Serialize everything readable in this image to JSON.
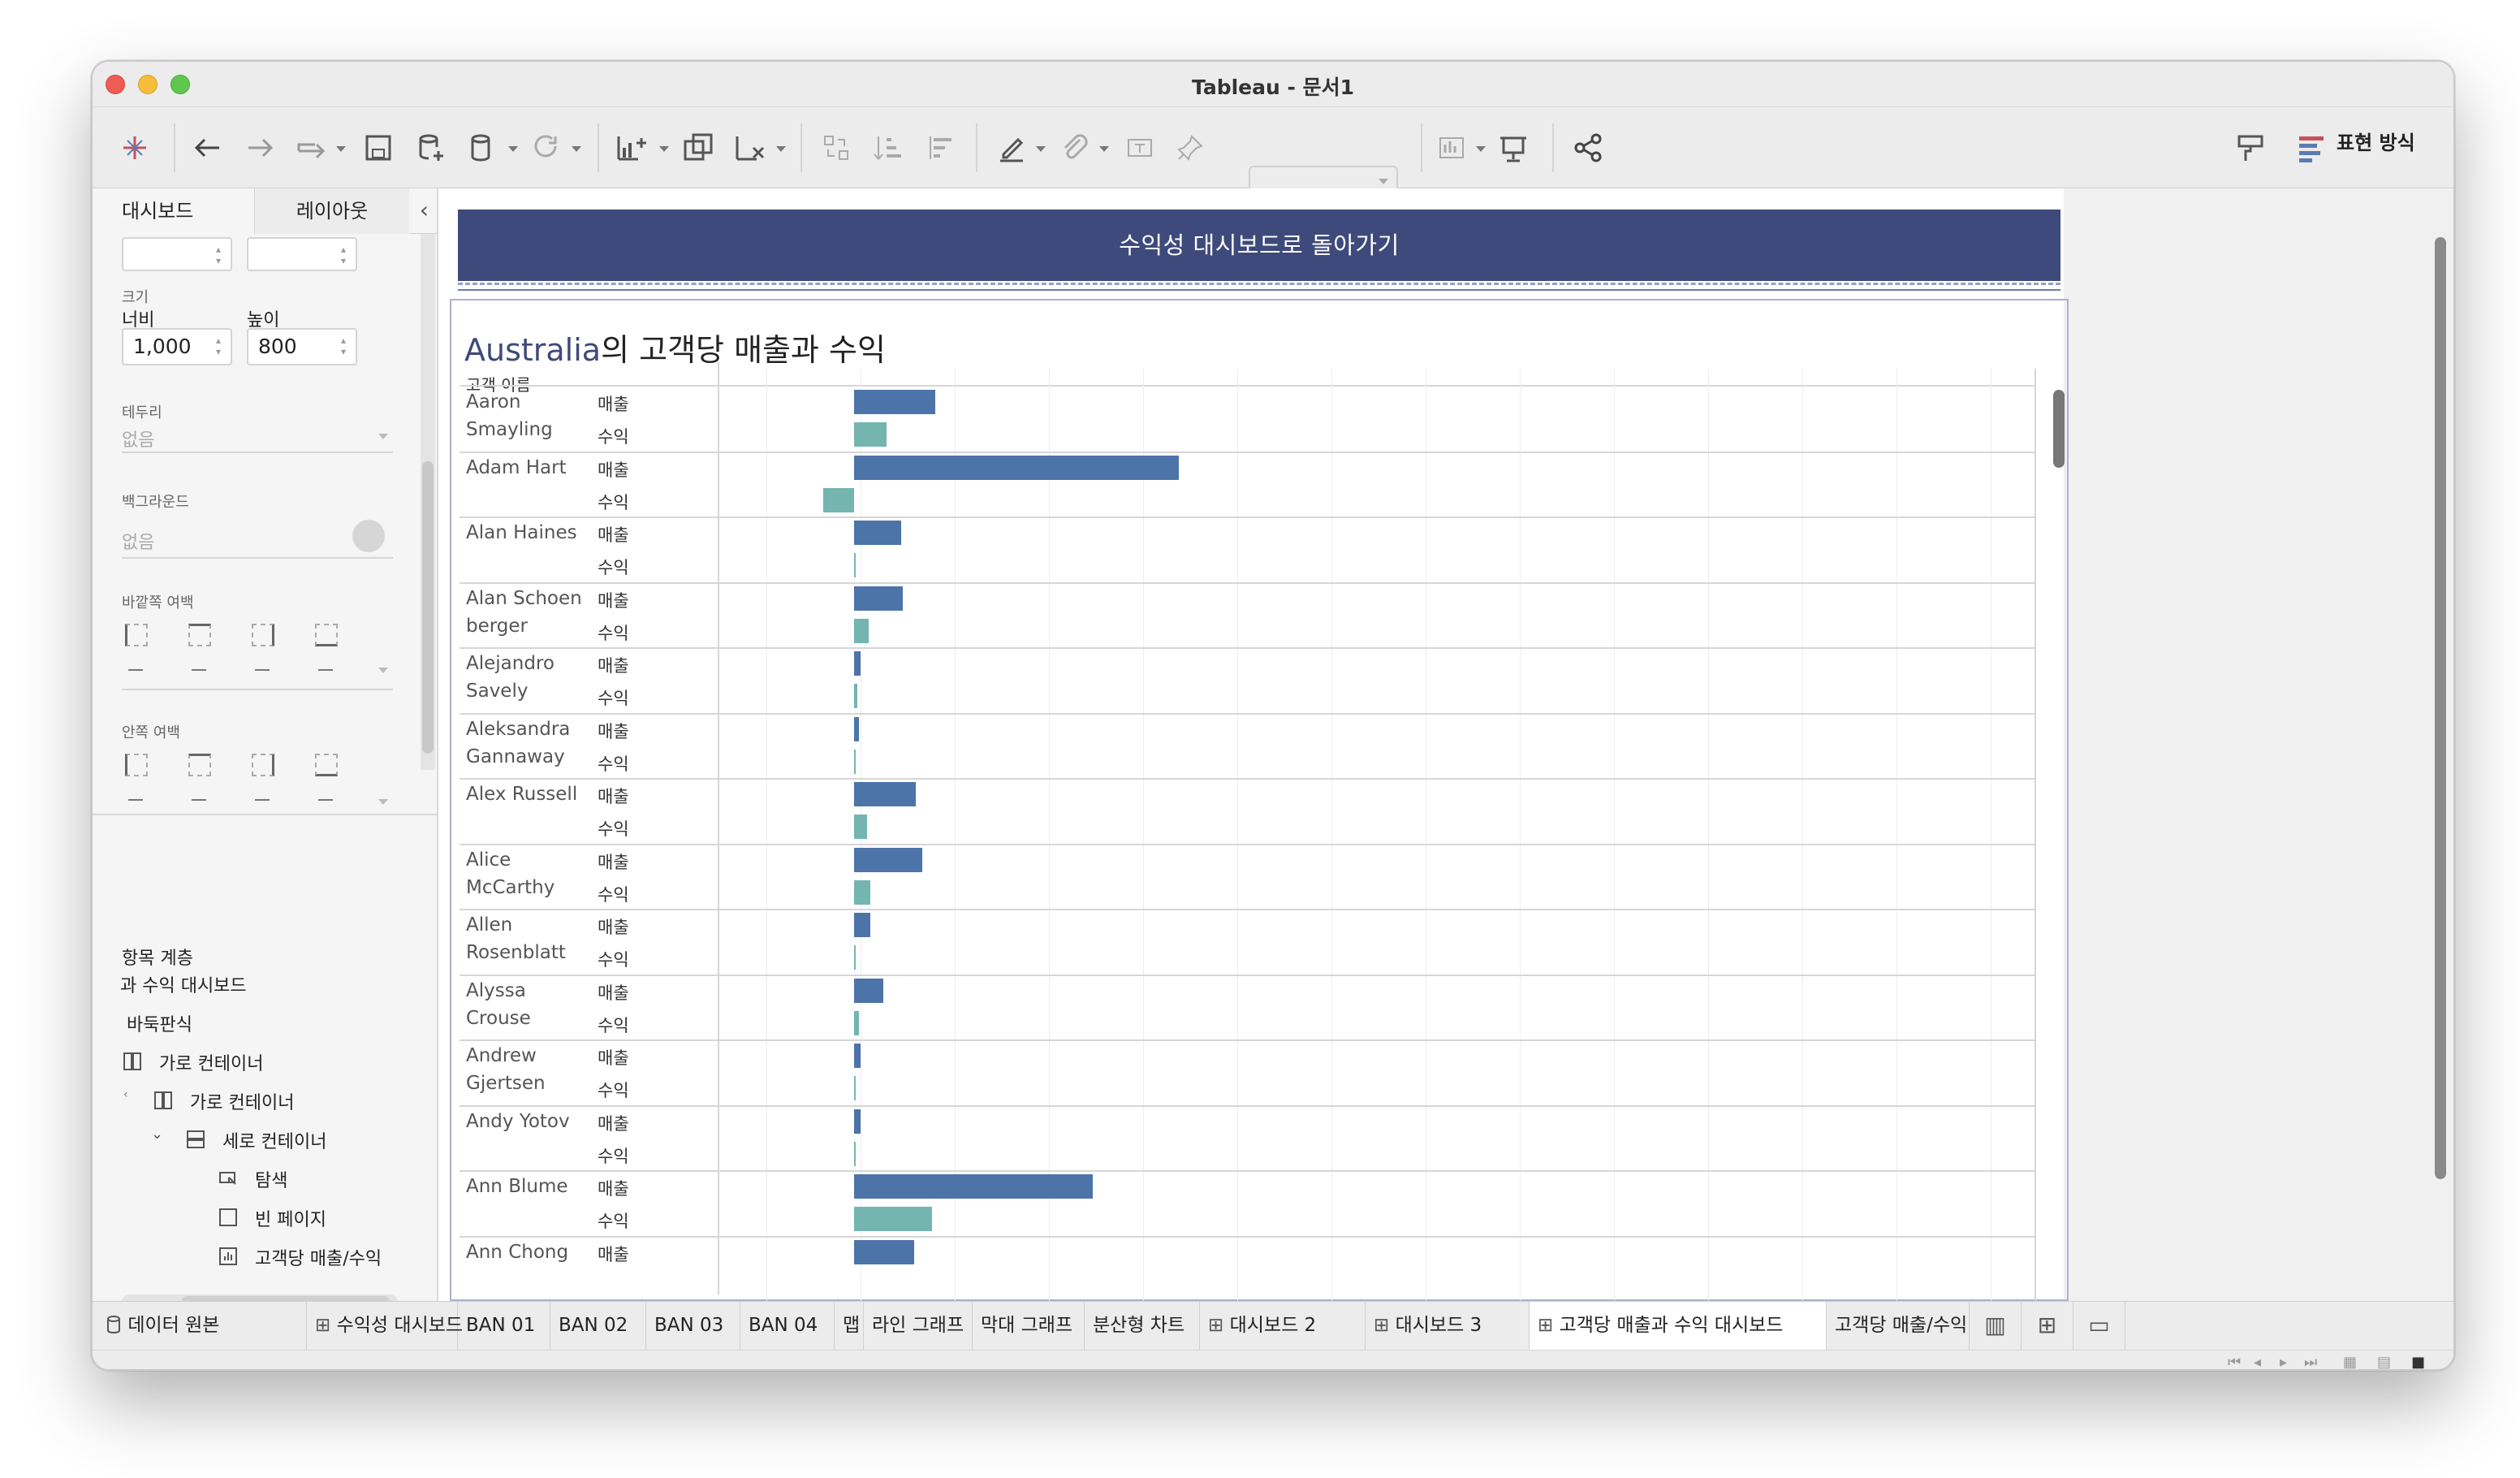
{
  "window": {
    "title": "Tableau - 문서1"
  },
  "toolbar": {
    "present_label": "표현 방식"
  },
  "left_pane": {
    "tabs": [
      {
        "label": "대시보드"
      },
      {
        "label": "레이아웃"
      }
    ],
    "size_label": "크기",
    "width_label": "너비",
    "height_label": "높이",
    "width_value": "1,000",
    "height_value": "800",
    "border_label": "테두리",
    "border_value": "없음",
    "background_label": "백그라운드",
    "background_value": "없음",
    "outer_padding_label": "바깥쪽 여백",
    "inner_padding_label": "안쪽 여백",
    "item_hierarchy_label": "항목 계층",
    "tree": [
      {
        "label": "과 수익 대시보드"
      },
      {
        "label": "바둑판식"
      },
      {
        "label": "가로 컨테이너"
      },
      {
        "label": "가로 컨테이너"
      },
      {
        "label": "세로 컨테이너"
      },
      {
        "label": "탐색"
      },
      {
        "label": "빈 페이지"
      },
      {
        "label": "고객당 매출/수익"
      }
    ]
  },
  "dashboard": {
    "banner": "수익성 대시보드로 돌아가기",
    "title_accent": "Australia",
    "title_rest": "의 고객당 매출과 수익",
    "row_header": "고객 이름",
    "measure_sales": "매출",
    "measure_profit": "수익"
  },
  "chart_data": {
    "type": "bar",
    "title": "Australia의 고객당 매출과 수익",
    "row_header": "고객 이름",
    "measures": [
      "매출",
      "수익"
    ],
    "categories": [
      "Aaron Smayling",
      "Adam Hart",
      "Alan Haines",
      "Alan Schoen berger",
      "Alejandro Savely",
      "Aleksandra Gannaway",
      "Alex Russell",
      "Alice McCarthy",
      "Allen Rosenblatt",
      "Alyssa Crouse",
      "Andrew Gjertsen",
      "Andy Yotov",
      "Ann Blume",
      "Ann Chong"
    ],
    "series": [
      {
        "name": "매출",
        "values": [
          50,
          200,
          29,
          30,
          4,
          3,
          38,
          42,
          10,
          18,
          4,
          4,
          147,
          37
        ]
      },
      {
        "name": "수익",
        "values": [
          20,
          -19,
          1,
          9,
          2,
          1,
          8,
          10,
          1,
          3,
          1,
          1,
          48,
          null
        ]
      }
    ],
    "axis_zero_note": "values in relative units; no axis ticks printed",
    "grid": true,
    "colors": {
      "매출": "#4d74a8",
      "수익": "#75b5b0",
      "accent": "#3e4a7b"
    }
  },
  "sheet_tabs": [
    {
      "label": "데이터 원본"
    },
    {
      "label": "수익성 대시보드"
    },
    {
      "label": "BAN 01"
    },
    {
      "label": "BAN 02"
    },
    {
      "label": "BAN 03"
    },
    {
      "label": "BAN 04"
    },
    {
      "label": "맵"
    },
    {
      "label": "라인 그래프"
    },
    {
      "label": "막대 그래프"
    },
    {
      "label": "분산형 차트"
    },
    {
      "label": "대시보드 2"
    },
    {
      "label": "대시보드 3"
    },
    {
      "label": "고객당 매출과 수익 대시보드"
    },
    {
      "label": "고객당 매출/수익"
    }
  ]
}
